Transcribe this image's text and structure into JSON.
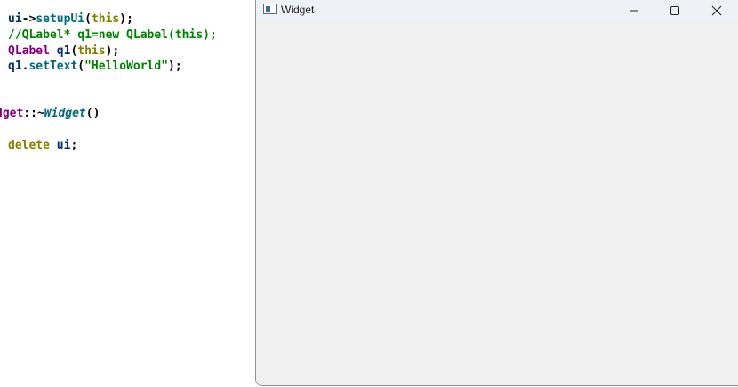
{
  "editor": {
    "lines": [
      [
        {
          "t": "ui",
          "c": "var"
        },
        {
          "t": "->",
          "c": "punc"
        },
        {
          "t": "setupUi",
          "c": "fn"
        },
        {
          "t": "(",
          "c": "punc"
        },
        {
          "t": "this",
          "c": "kw"
        },
        {
          "t": ");",
          "c": "punc"
        }
      ],
      [
        {
          "t": "//QLabel* q1=new QLabel(this);",
          "c": "cmt"
        }
      ],
      [
        {
          "t": "QLabel",
          "c": "type"
        },
        {
          "t": " ",
          "c": "punc"
        },
        {
          "t": "q1",
          "c": "var"
        },
        {
          "t": "(",
          "c": "punc"
        },
        {
          "t": "this",
          "c": "kw"
        },
        {
          "t": ");",
          "c": "punc"
        }
      ],
      [
        {
          "t": "q1",
          "c": "var"
        },
        {
          "t": ".",
          "c": "punc"
        },
        {
          "t": "setText",
          "c": "fn"
        },
        {
          "t": "(",
          "c": "punc"
        },
        {
          "t": "\"HelloWorld\"",
          "c": "str"
        },
        {
          "t": ");",
          "c": "punc"
        }
      ],
      [
        {
          "t": "dget",
          "c": "type"
        },
        {
          "t": "::~",
          "c": "punc"
        },
        {
          "t": "Widget",
          "c": "fn",
          "italic": true
        },
        {
          "t": "()",
          "c": "punc"
        }
      ],
      [
        {
          "t": "delete",
          "c": "kw"
        },
        {
          "t": " ",
          "c": "punc"
        },
        {
          "t": "ui",
          "c": "var"
        },
        {
          "t": ";",
          "c": "punc"
        }
      ]
    ]
  },
  "window": {
    "title": "Widget",
    "icon": "qt-app-icon",
    "buttons": {
      "minimize": "minimize-icon",
      "maximize": "maximize-icon",
      "close": "close-icon"
    }
  },
  "colors": {
    "keyword": "#808000",
    "type": "#800080",
    "function": "#00677c",
    "variable": "#092e64",
    "string": "#008000",
    "comment": "#008000",
    "window_bg": "#f0f0f0",
    "titlebar_bg": "#eef2f7"
  }
}
